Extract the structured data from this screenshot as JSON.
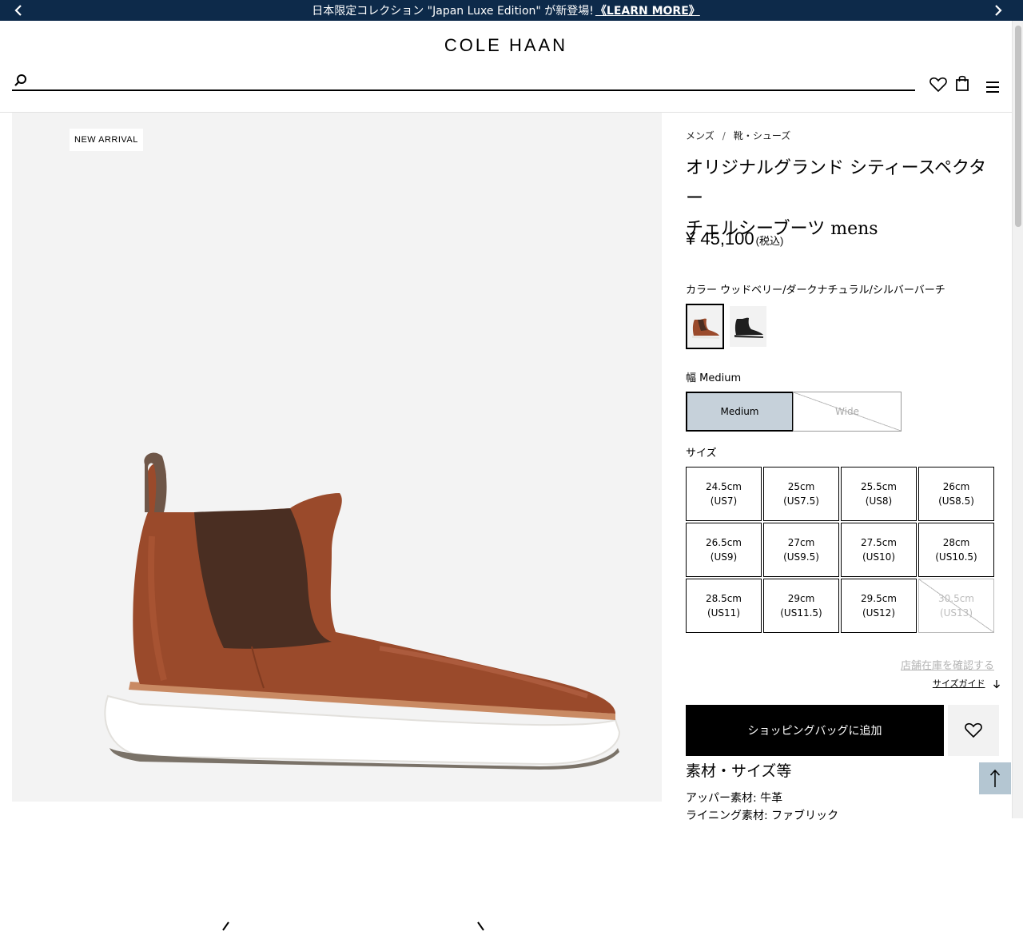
{
  "promo": {
    "text": "日本限定コレクション \"Japan Luxe Edition\" が新登場!",
    "link": "《LEARN MORE》",
    "prev_icon": "chevron-left-icon",
    "next_icon": "chevron-right-icon"
  },
  "header": {
    "logo": "COLE HAAN",
    "search_placeholder": "",
    "icons": [
      "search-icon",
      "heart-icon",
      "shopping-bag-icon",
      "menu-icon"
    ]
  },
  "gallery": {
    "badge": "NEW ARRIVAL"
  },
  "product": {
    "breadcrumb": [
      "メンズ",
      "靴・シューズ"
    ],
    "breadcrumb_sep": "/",
    "title_line1": "オリジナルグランド シティースペクター",
    "title_line2": "チェルシーブーツ mens",
    "price": "¥ 45,100",
    "tax": "(税込)",
    "color_label": "カラー",
    "color_value": "ウッドベリー/ダークナチュラル/シルバーバーチ",
    "width_label": "幅",
    "width_value": "Medium",
    "widths": [
      {
        "label": "Medium",
        "selected": true,
        "available": true
      },
      {
        "label": "Wide",
        "selected": false,
        "available": false
      }
    ],
    "size_label": "サイズ",
    "sizes": [
      {
        "cm": "24.5cm",
        "us": "(US7)",
        "available": true
      },
      {
        "cm": "25cm",
        "us": "(US7.5)",
        "available": true
      },
      {
        "cm": "25.5cm",
        "us": "(US8)",
        "available": true
      },
      {
        "cm": "26cm",
        "us": "(US8.5)",
        "available": true
      },
      {
        "cm": "26.5cm",
        "us": "(US9)",
        "available": true
      },
      {
        "cm": "27cm",
        "us": "(US9.5)",
        "available": true
      },
      {
        "cm": "27.5cm",
        "us": "(US10)",
        "available": true
      },
      {
        "cm": "28cm",
        "us": "(US10.5)",
        "available": true
      },
      {
        "cm": "28.5cm",
        "us": "(US11)",
        "available": true
      },
      {
        "cm": "29cm",
        "us": "(US11.5)",
        "available": true
      },
      {
        "cm": "29.5cm",
        "us": "(US12)",
        "available": true
      },
      {
        "cm": "30.5cm",
        "us": "(US13)",
        "available": false
      }
    ],
    "store_stock": "店舗在庫を確認する",
    "size_guide": "サイズガイド",
    "add_to_bag": "ショッピングバッグに追加",
    "spec_title": "素材・サイズ等",
    "spec_upper": "アッパー素材: 牛革",
    "spec_lining": "ライニング素材: ファブリック"
  },
  "colors": {
    "promo_bg": "#0d2a4a",
    "width_selected_bg": "#c6d1da",
    "to_top_bg": "#b4c6d2",
    "leather": "#9a4a2b"
  }
}
